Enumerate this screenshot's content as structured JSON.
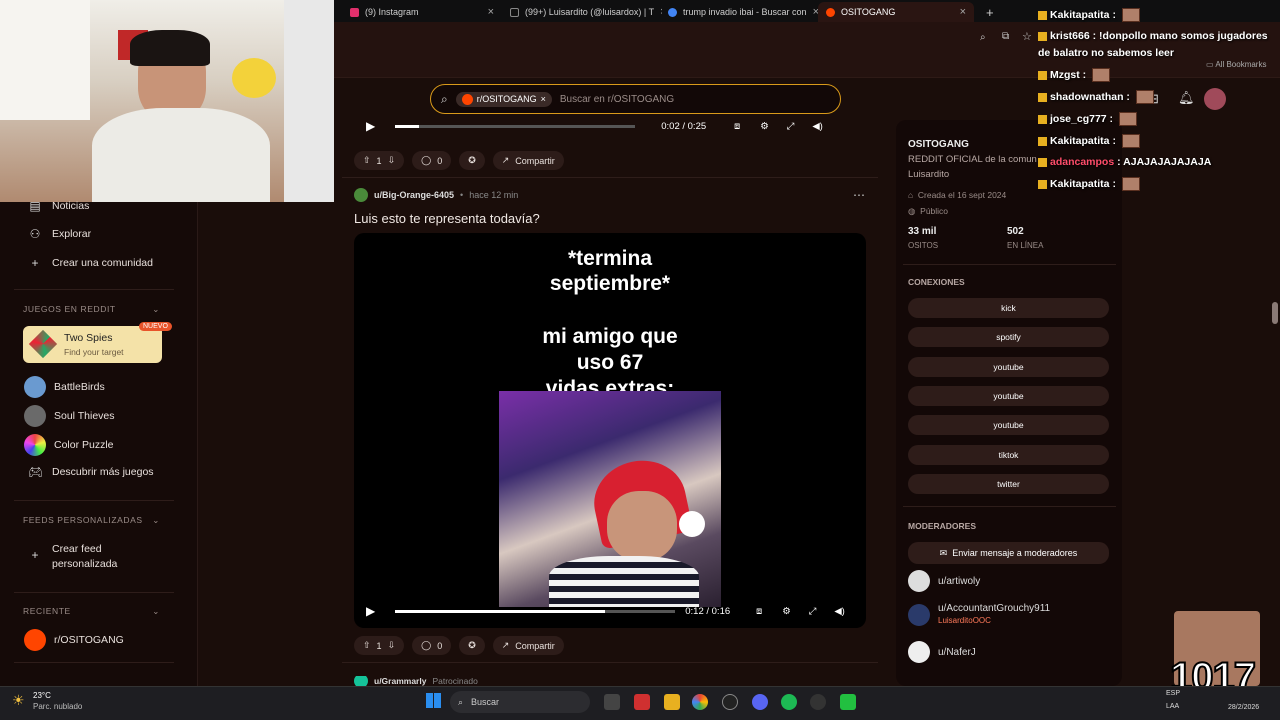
{
  "browser": {
    "tabs": [
      {
        "label": "(9) Instagram",
        "color": "#e1306c"
      },
      {
        "label": "(99+) Luisardito (@luisardox) | T",
        "color": "#111111"
      },
      {
        "label": "trump invadio ibai - Buscar con",
        "color": "#4285f4"
      },
      {
        "label": "OSITOGANG",
        "color": "#ff4500"
      }
    ],
    "bookmarks_label": "All Bookmarks"
  },
  "search": {
    "chip": "r/OSITOGANG",
    "placeholder": "Buscar en r/OSITOGANG"
  },
  "sidebar": {
    "nav": [
      "Noticias",
      "Explorar",
      "Crear una comunidad"
    ],
    "games_heading": "JUEGOS EN REDDIT",
    "featured_game": {
      "title": "Two Spies",
      "subtitle": "Find your target",
      "badge": "NUEVO"
    },
    "games": [
      "BattleBirds",
      "Soul Thieves",
      "Color Puzzle"
    ],
    "more_games": "Descubrir más juegos",
    "feeds_heading": "FEEDS PERSONALIZADAS",
    "create_feed": [
      "Crear feed",
      "personalizada"
    ],
    "recent_heading": "RECIENTE",
    "recent": [
      "r/OSITOGANG"
    ]
  },
  "feed": {
    "top_player": {
      "time": "0:02 / 0:25",
      "progress": 0.1
    },
    "top_actions": {
      "votes": "1",
      "comments": "0",
      "share": "Compartir"
    },
    "post": {
      "author": "u/Big-Orange-6405",
      "time": "hace 12 min",
      "title": "Luis esto te representa todavía?",
      "caption1": "*termina",
      "caption2": "septiembre*",
      "caption3": "mi amigo que",
      "caption4": "uso 67",
      "caption5": "vidas extras:",
      "player": {
        "time": "0:12 / 0:16",
        "progress": 0.75
      },
      "votes": "1",
      "comments": "0",
      "share": "Compartir"
    },
    "next_post": {
      "author": "u/Grammarly",
      "tag": "Patrocinado"
    }
  },
  "community": {
    "name": "OSITOGANG",
    "description_lines": [
      "REDDIT OFICIAL de la comun",
      "Luisardito"
    ],
    "created": "Creada el 16 sept 2024",
    "visibility": "Público",
    "members": "33 mil",
    "members_label": "OSITOS",
    "online": "502",
    "online_label": "EN LÍNEA",
    "connections_heading": "CONEXIONES",
    "connections": [
      "kick",
      "spotify",
      "youtube",
      "youtube",
      "youtube",
      "tiktok",
      "twitter"
    ],
    "moderators_heading": "MODERADORES",
    "message_mods": "Enviar mensaje a moderadores",
    "moderators": [
      {
        "name": "u/artiwoly",
        "flair": ""
      },
      {
        "name": "u/AccountantGrouchy911",
        "flair": "LuisarditoOOC"
      },
      {
        "name": "u/NaferJ",
        "flair": ""
      }
    ]
  },
  "chat": [
    {
      "user": "Kakitapatita",
      "text": "",
      "color": "#ffffff"
    },
    {
      "user": "krist666",
      "text": "!donpollo mano somos jugadores",
      "color": "#ffffff"
    },
    {
      "user": "",
      "text": "de balatro no sabemos leer",
      "color": "#ffffff"
    },
    {
      "user": "Mzgst",
      "text": "",
      "color": "#ffffff"
    },
    {
      "user": "shadownathan",
      "text": "",
      "color": "#ffffff"
    },
    {
      "user": "jose_cg777",
      "text": "",
      "color": "#ffffff"
    },
    {
      "user": "Kakitapatita",
      "text": "",
      "color": "#ffffff"
    },
    {
      "user": "adancampos",
      "text": "AJAJAJAJAJAJA",
      "color": "#ff4d6a"
    },
    {
      "user": "Kakitapatita",
      "text": "",
      "color": "#ffffff"
    }
  ],
  "overlay_counter": "1017",
  "taskbar": {
    "weather_temp": "23°C",
    "weather_desc": "Parc. nublado",
    "search": "Buscar",
    "lang": "ESP",
    "lang2": "LAA",
    "date": "28/2/2026"
  }
}
